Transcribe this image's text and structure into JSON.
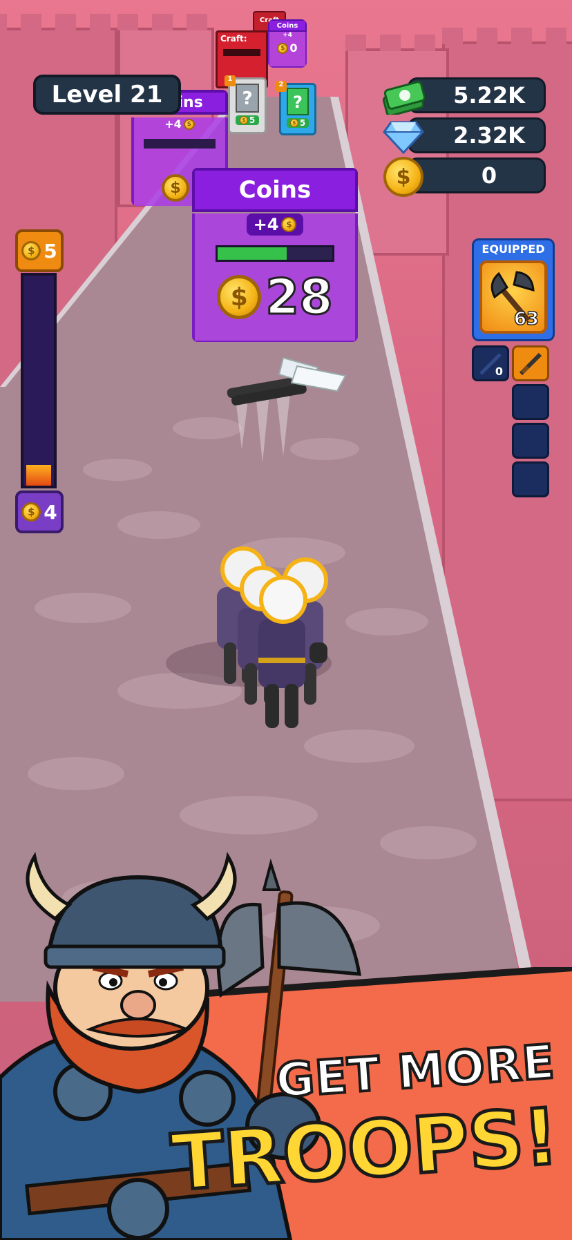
{
  "hud": {
    "level": "Level 21",
    "cash": "5.22K",
    "gems": "2.32K",
    "coins": "0"
  },
  "meter": {
    "top_value": "5",
    "bottom_value": "4",
    "fill": 0.1
  },
  "gate_main": {
    "title": "Coins",
    "bonus": "+4",
    "value": "28",
    "progress": 0.6
  },
  "gate_back": {
    "title": "Coins",
    "bonus": "+4"
  },
  "distant": {
    "craft_label": "Craft:",
    "far_craft_label": "Craft",
    "far_coins_label": "Coins",
    "far_coins_bonus": "+4",
    "far_coins_value": "0",
    "card1_num": "1",
    "card1_cost": "5",
    "card1_symbol": "?",
    "card2_num": "2",
    "card2_cost": "5",
    "card2_symbol": "?"
  },
  "equipped": {
    "header": "EQUIPPED",
    "main_count": "63",
    "slot_count": "0"
  },
  "banner": {
    "line1": "GET MORE",
    "line2": "TROOPS!"
  },
  "icons": {
    "cash": "cash-stack-icon",
    "gem": "diamond-icon",
    "coin": "coin-icon",
    "weapon": "battle-axe-icon"
  },
  "colors": {
    "gate_purple": "#8b1fe0",
    "hud_dark": "#243447",
    "banner_orange": "#f36b4a",
    "troops_yellow": "#ffd633"
  }
}
